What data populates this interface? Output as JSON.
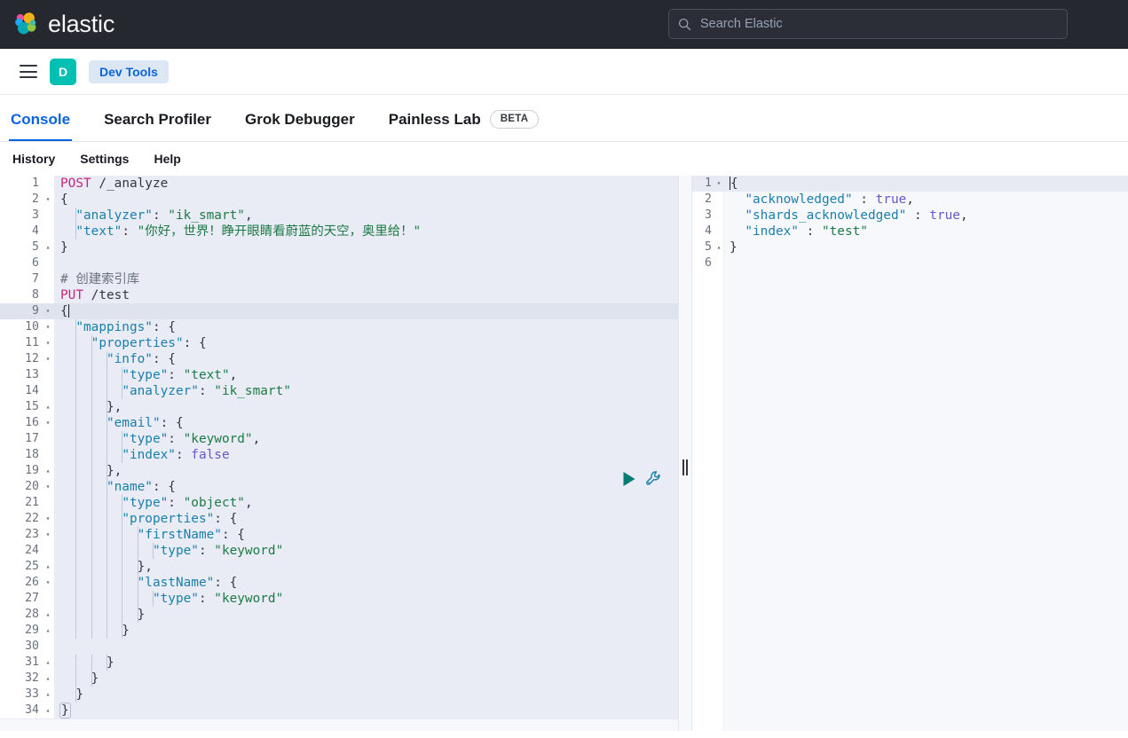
{
  "header": {
    "brand_name": "elastic",
    "logo_icon": "elastic-logo-icon",
    "search": {
      "icon": "search-icon",
      "placeholder": "Search Elastic",
      "value": ""
    }
  },
  "breadcrumb_bar": {
    "menu_icon": "hamburger-menu-icon",
    "space_avatar_letter": "D",
    "space_avatar_color": "#00bfb3",
    "breadcrumb": "Dev Tools"
  },
  "tabs": {
    "accent_color": "#0b64dd",
    "items": [
      {
        "label": "Console",
        "active": true,
        "badge": null
      },
      {
        "label": "Search Profiler",
        "active": false,
        "badge": null
      },
      {
        "label": "Grok Debugger",
        "active": false,
        "badge": null
      },
      {
        "label": "Painless Lab",
        "active": false,
        "badge": "BETA"
      }
    ]
  },
  "submenu": {
    "items": [
      "History",
      "Settings",
      "Help"
    ]
  },
  "editor": {
    "title": "request-editor",
    "active_line": 9,
    "run_icon": "play-icon",
    "run_icon_color": "#017d73",
    "wrench_icon": "wrench-icon",
    "wrench_icon_color": "#1a7faa",
    "lines": [
      {
        "n": 1,
        "fold": "",
        "tokens": [
          {
            "t": "method",
            "v": "POST"
          },
          {
            "t": "punct",
            "v": " "
          },
          {
            "t": "url",
            "v": "/_analyze"
          }
        ]
      },
      {
        "n": 2,
        "fold": "▾",
        "tokens": [
          {
            "t": "punct",
            "v": "{"
          }
        ]
      },
      {
        "n": 3,
        "fold": "",
        "tokens": [
          {
            "t": "punct",
            "v": "  "
          },
          {
            "t": "key",
            "v": "\"analyzer\""
          },
          {
            "t": "punct",
            "v": ": "
          },
          {
            "t": "str",
            "v": "\"ik_smart\""
          },
          {
            "t": "punct",
            "v": ","
          }
        ]
      },
      {
        "n": 4,
        "fold": "",
        "tokens": [
          {
            "t": "punct",
            "v": "  "
          },
          {
            "t": "key",
            "v": "\"text\""
          },
          {
            "t": "punct",
            "v": ": "
          },
          {
            "t": "str",
            "v": "\"你好，世界！睁开眼睛看蔚蓝的天空，奥里给！\""
          }
        ]
      },
      {
        "n": 5,
        "fold": "▴",
        "tokens": [
          {
            "t": "punct",
            "v": "}"
          }
        ]
      },
      {
        "n": 6,
        "fold": "",
        "tokens": []
      },
      {
        "n": 7,
        "fold": "",
        "tokens": [
          {
            "t": "comment",
            "v": "# 创建索引库"
          }
        ]
      },
      {
        "n": 8,
        "fold": "",
        "tokens": [
          {
            "t": "method",
            "v": "PUT"
          },
          {
            "t": "punct",
            "v": " "
          },
          {
            "t": "url",
            "v": "/test"
          }
        ]
      },
      {
        "n": 9,
        "fold": "▾",
        "tokens": [
          {
            "t": "punct",
            "v": "{"
          }
        ]
      },
      {
        "n": 10,
        "fold": "▾",
        "tokens": [
          {
            "t": "punct",
            "v": "  "
          },
          {
            "t": "key",
            "v": "\"mappings\""
          },
          {
            "t": "punct",
            "v": ": {"
          }
        ]
      },
      {
        "n": 11,
        "fold": "▾",
        "tokens": [
          {
            "t": "punct",
            "v": "    "
          },
          {
            "t": "key",
            "v": "\"properties\""
          },
          {
            "t": "punct",
            "v": ": {"
          }
        ]
      },
      {
        "n": 12,
        "fold": "▾",
        "tokens": [
          {
            "t": "punct",
            "v": "      "
          },
          {
            "t": "key",
            "v": "\"info\""
          },
          {
            "t": "punct",
            "v": ": {"
          }
        ]
      },
      {
        "n": 13,
        "fold": "",
        "tokens": [
          {
            "t": "punct",
            "v": "        "
          },
          {
            "t": "key",
            "v": "\"type\""
          },
          {
            "t": "punct",
            "v": ": "
          },
          {
            "t": "str",
            "v": "\"text\""
          },
          {
            "t": "punct",
            "v": ","
          }
        ]
      },
      {
        "n": 14,
        "fold": "",
        "tokens": [
          {
            "t": "punct",
            "v": "        "
          },
          {
            "t": "key",
            "v": "\"analyzer\""
          },
          {
            "t": "punct",
            "v": ": "
          },
          {
            "t": "str",
            "v": "\"ik_smart\""
          }
        ]
      },
      {
        "n": 15,
        "fold": "▴",
        "tokens": [
          {
            "t": "punct",
            "v": "      },"
          }
        ]
      },
      {
        "n": 16,
        "fold": "▾",
        "tokens": [
          {
            "t": "punct",
            "v": "      "
          },
          {
            "t": "key",
            "v": "\"email\""
          },
          {
            "t": "punct",
            "v": ": {"
          }
        ]
      },
      {
        "n": 17,
        "fold": "",
        "tokens": [
          {
            "t": "punct",
            "v": "        "
          },
          {
            "t": "key",
            "v": "\"type\""
          },
          {
            "t": "punct",
            "v": ": "
          },
          {
            "t": "str",
            "v": "\"keyword\""
          },
          {
            "t": "punct",
            "v": ","
          }
        ]
      },
      {
        "n": 18,
        "fold": "",
        "tokens": [
          {
            "t": "punct",
            "v": "        "
          },
          {
            "t": "key",
            "v": "\"index\""
          },
          {
            "t": "punct",
            "v": ": "
          },
          {
            "t": "bool",
            "v": "false"
          }
        ]
      },
      {
        "n": 19,
        "fold": "▴",
        "tokens": [
          {
            "t": "punct",
            "v": "      },"
          }
        ]
      },
      {
        "n": 20,
        "fold": "▾",
        "tokens": [
          {
            "t": "punct",
            "v": "      "
          },
          {
            "t": "key",
            "v": "\"name\""
          },
          {
            "t": "punct",
            "v": ": {"
          }
        ]
      },
      {
        "n": 21,
        "fold": "",
        "tokens": [
          {
            "t": "punct",
            "v": "        "
          },
          {
            "t": "key",
            "v": "\"type\""
          },
          {
            "t": "punct",
            "v": ": "
          },
          {
            "t": "str",
            "v": "\"object\""
          },
          {
            "t": "punct",
            "v": ","
          }
        ]
      },
      {
        "n": 22,
        "fold": "▾",
        "tokens": [
          {
            "t": "punct",
            "v": "        "
          },
          {
            "t": "key",
            "v": "\"properties\""
          },
          {
            "t": "punct",
            "v": ": {"
          }
        ]
      },
      {
        "n": 23,
        "fold": "▾",
        "tokens": [
          {
            "t": "punct",
            "v": "          "
          },
          {
            "t": "key",
            "v": "\"firstName\""
          },
          {
            "t": "punct",
            "v": ": {"
          }
        ]
      },
      {
        "n": 24,
        "fold": "",
        "tokens": [
          {
            "t": "punct",
            "v": "            "
          },
          {
            "t": "key",
            "v": "\"type\""
          },
          {
            "t": "punct",
            "v": ": "
          },
          {
            "t": "str",
            "v": "\"keyword\""
          }
        ]
      },
      {
        "n": 25,
        "fold": "▴",
        "tokens": [
          {
            "t": "punct",
            "v": "          },"
          }
        ]
      },
      {
        "n": 26,
        "fold": "▾",
        "tokens": [
          {
            "t": "punct",
            "v": "          "
          },
          {
            "t": "key",
            "v": "\"lastName\""
          },
          {
            "t": "punct",
            "v": ": {"
          }
        ]
      },
      {
        "n": 27,
        "fold": "",
        "tokens": [
          {
            "t": "punct",
            "v": "            "
          },
          {
            "t": "key",
            "v": "\"type\""
          },
          {
            "t": "punct",
            "v": ": "
          },
          {
            "t": "str",
            "v": "\"keyword\""
          }
        ]
      },
      {
        "n": 28,
        "fold": "▴",
        "tokens": [
          {
            "t": "punct",
            "v": "          }"
          }
        ]
      },
      {
        "n": 29,
        "fold": "▴",
        "tokens": [
          {
            "t": "punct",
            "v": "        }"
          }
        ]
      },
      {
        "n": 30,
        "fold": "",
        "tokens": []
      },
      {
        "n": 31,
        "fold": "▴",
        "tokens": [
          {
            "t": "punct",
            "v": "      }"
          }
        ]
      },
      {
        "n": 32,
        "fold": "▴",
        "tokens": [
          {
            "t": "punct",
            "v": "    }"
          }
        ]
      },
      {
        "n": 33,
        "fold": "▴",
        "tokens": [
          {
            "t": "punct",
            "v": "  }"
          }
        ]
      },
      {
        "n": 34,
        "fold": "▴",
        "tokens": [
          {
            "t": "punct",
            "v": "}"
          }
        ]
      }
    ]
  },
  "response": {
    "title": "response-viewer",
    "active_line": 1,
    "lines": [
      {
        "n": 1,
        "fold": "▾",
        "tokens": [
          {
            "t": "punct",
            "v": "{"
          }
        ]
      },
      {
        "n": 2,
        "fold": "",
        "tokens": [
          {
            "t": "punct",
            "v": "  "
          },
          {
            "t": "key",
            "v": "\"acknowledged\""
          },
          {
            "t": "punct",
            "v": " : "
          },
          {
            "t": "bool",
            "v": "true"
          },
          {
            "t": "punct",
            "v": ","
          }
        ]
      },
      {
        "n": 3,
        "fold": "",
        "tokens": [
          {
            "t": "punct",
            "v": "  "
          },
          {
            "t": "key",
            "v": "\"shards_acknowledged\""
          },
          {
            "t": "punct",
            "v": " : "
          },
          {
            "t": "bool",
            "v": "true"
          },
          {
            "t": "punct",
            "v": ","
          }
        ]
      },
      {
        "n": 4,
        "fold": "",
        "tokens": [
          {
            "t": "punct",
            "v": "  "
          },
          {
            "t": "key",
            "v": "\"index\""
          },
          {
            "t": "punct",
            "v": " : "
          },
          {
            "t": "str",
            "v": "\"test\""
          }
        ]
      },
      {
        "n": 5,
        "fold": "▴",
        "tokens": [
          {
            "t": "punct",
            "v": "}"
          }
        ]
      },
      {
        "n": 6,
        "fold": "",
        "tokens": []
      }
    ]
  },
  "splitter": {
    "label": "pane-resize-handle"
  }
}
